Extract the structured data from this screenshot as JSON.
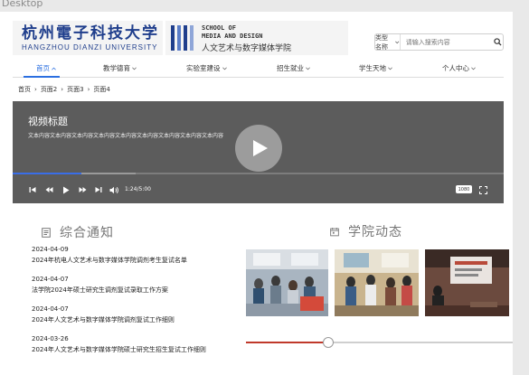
{
  "frame": {
    "label": "Desktop"
  },
  "header": {
    "logo_cn": "杭州電子科技大学",
    "logo_en": "HANGZHOU DIANZI UNIVERSITY",
    "school_en_1": "SCHOOL OF",
    "school_en_2": "MEDIA AND DESIGN",
    "school_cn": "人文艺术与数字媒体学院",
    "search": {
      "scope_label": "类型名称",
      "placeholder": "请输入搜索内容"
    }
  },
  "nav": {
    "items": [
      {
        "label": "首页",
        "active": true
      },
      {
        "label": "教学德育"
      },
      {
        "label": "实验室建设"
      },
      {
        "label": "招生就业"
      },
      {
        "label": "学生天地"
      },
      {
        "label": "个人中心"
      }
    ]
  },
  "breadcrumb": [
    "首页",
    "页面2",
    "页面3",
    "页面4"
  ],
  "video": {
    "title": "视频标题",
    "description": "文本内容文本内容文本内容文本内容文本内容文本内容文本内容文本内容文本内容",
    "time": "1:24/5:00",
    "quality": "1080",
    "played_fraction": 0.14,
    "buffered_fraction": 0.25
  },
  "notices": {
    "title": "综合通知",
    "items": [
      {
        "date": "2024-04-09",
        "headline": "2024年杭电人文艺术与数字媒体学院调剂考生复试名单"
      },
      {
        "date": "2024-04-07",
        "headline": "法学院2024年硕士研究生调剂复试录取工作方案"
      },
      {
        "date": "2024-04-07",
        "headline": "2024年人文艺术与数字媒体学院调剂复试工作细则"
      },
      {
        "date": "2024-03-26",
        "headline": "2024年人文艺术与数字媒体学院硕士研究生招生复试工作细则"
      }
    ]
  },
  "news": {
    "title": "学院动态",
    "carousel_fraction": 0.31
  },
  "colors": {
    "accent": "#2b6fe0",
    "brand": "#1f3e8c",
    "slider": "#c0392b",
    "video_bg": "#5c5c5c"
  }
}
